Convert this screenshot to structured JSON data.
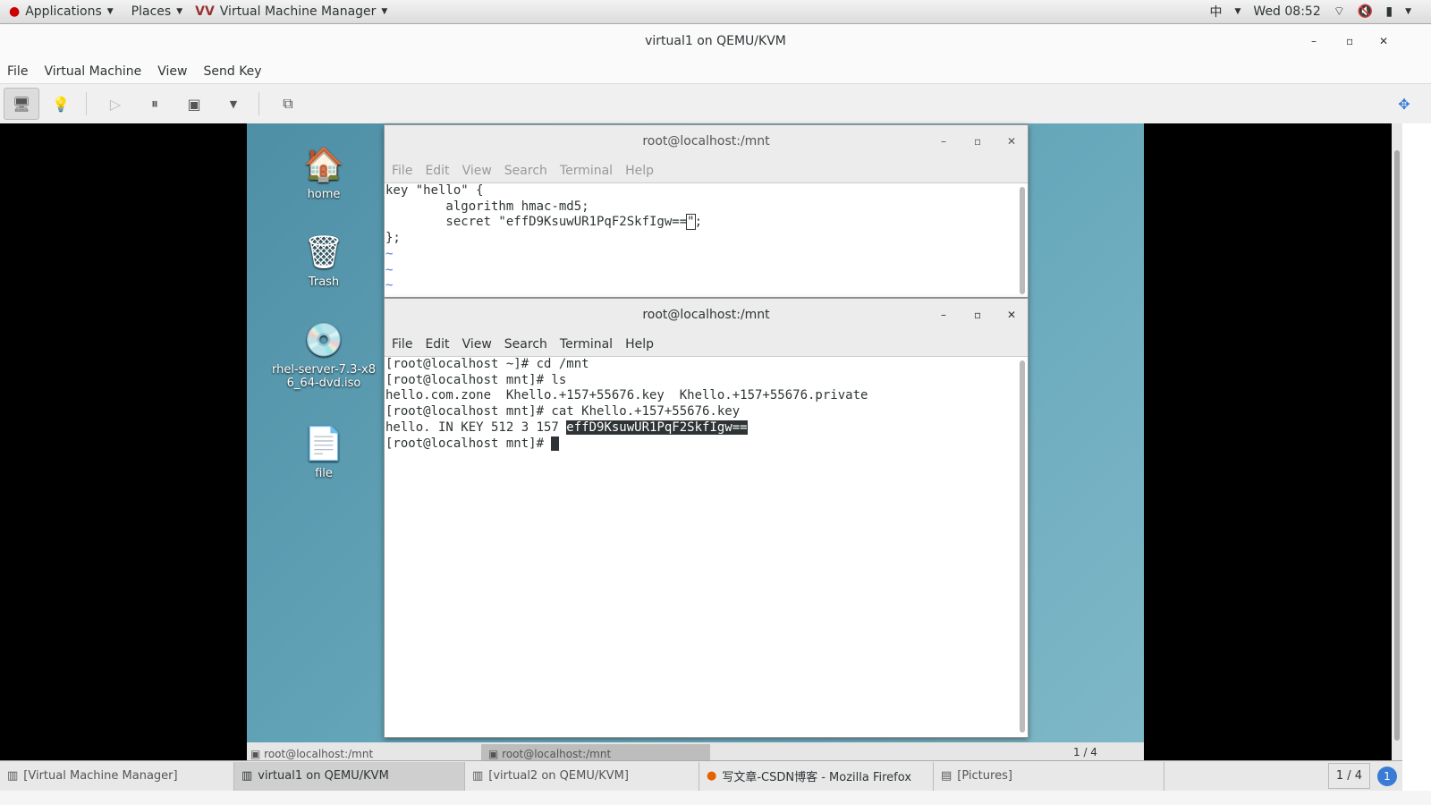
{
  "topbar": {
    "applications": "Applications",
    "places": "Places",
    "app_menu": "Virtual Machine Manager",
    "input_method": "中",
    "clock": "Wed 08:52"
  },
  "window": {
    "title": "virtual1 on QEMU/KVM",
    "minimize": "–",
    "maximize": "▫",
    "close": "✕"
  },
  "menu": [
    "File",
    "Virtual Machine",
    "View",
    "Send Key"
  ],
  "toolbar": {
    "icons": [
      "monitor-icon",
      "lightbulb-icon",
      "play-icon",
      "pause-icon",
      "power-icon",
      "dropdown-icon",
      "screenshot-icon",
      "fullscreen-icon"
    ]
  },
  "desktop": {
    "icons": [
      {
        "label": "home",
        "glyph": "🏠"
      },
      {
        "label": "Trash",
        "glyph": "🗑"
      },
      {
        "label": "rhel-server-7.3-x86_64-dvd.iso",
        "glyph": "💿"
      },
      {
        "label": "file",
        "glyph": "📄"
      }
    ]
  },
  "term_menu": [
    "File",
    "Edit",
    "View",
    "Search",
    "Terminal",
    "Help"
  ],
  "term1": {
    "title": "root@localhost:/mnt",
    "lines": [
      "key \"hello\" {",
      "        algorithm hmac-md5;",
      "        secret \"effD9KsuwUR1PqF2SkfIgw==",
      "};"
    ],
    "after_cursor": ";",
    "cursor_char": "\"",
    "tildes": [
      "~",
      "~",
      "~"
    ]
  },
  "term2": {
    "title": "root@localhost:/mnt",
    "lines": [
      "[root@localhost ~]# cd /mnt",
      "[root@localhost mnt]# ls",
      "hello.com.zone  Khello.+157+55676.key  Khello.+157+55676.private",
      "[root@localhost mnt]# cat Khello.+157+55676.key"
    ],
    "key_prefix": "hello. IN KEY 512 3 157 ",
    "key_selected": "effD9KsuwUR1PqF2SkfIgw==",
    "prompt": "[root@localhost mnt]# "
  },
  "guest_taskbar": {
    "items": [
      "root@localhost:/mnt",
      "root@localhost:/mnt"
    ],
    "workspace": "1 / 4"
  },
  "taskbar": {
    "items": [
      "[Virtual Machine Manager]",
      "virtual1 on QEMU/KVM",
      "[virtual2 on QEMU/KVM]",
      "写文章-CSDN博客 - Mozilla Firefox",
      "[Pictures]"
    ],
    "active_index": 1,
    "workspace": "1 / 4",
    "notification_count": "1"
  }
}
